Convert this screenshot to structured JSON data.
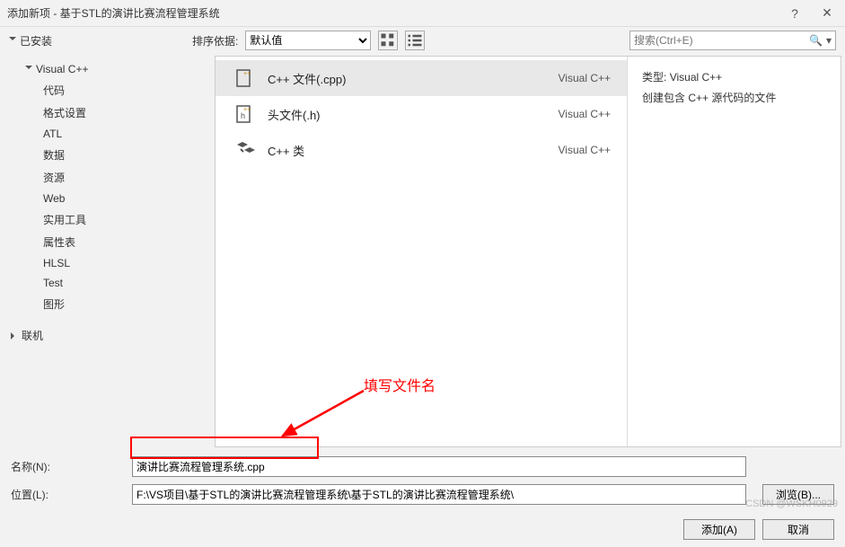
{
  "window": {
    "title": "添加新项 - 基于STL的演讲比赛流程管理系统",
    "help": "?",
    "close": "✕"
  },
  "toolbar": {
    "installed_label": "已安装",
    "sort_label": "排序依据:",
    "sort_value": "默认值",
    "search_placeholder": "搜索(Ctrl+E)"
  },
  "sidebar": {
    "root": "Visual C++",
    "children": [
      "代码",
      "格式设置",
      "ATL",
      "数据",
      "资源",
      "Web",
      "实用工具",
      "属性表",
      "HLSL",
      "Test",
      "图形"
    ],
    "online": "联机"
  },
  "items": [
    {
      "name": "C++ 文件(.cpp)",
      "lang": "Visual C++",
      "selected": true
    },
    {
      "name": "头文件(.h)",
      "lang": "Visual C++",
      "selected": false
    },
    {
      "name": "C++ 类",
      "lang": "Visual C++",
      "selected": false
    }
  ],
  "detail": {
    "type_label": "类型:",
    "type_value": "Visual C++",
    "description": "创建包含 C++ 源代码的文件"
  },
  "form": {
    "name_label": "名称(N):",
    "name_value": "演讲比赛流程管理系统.cpp",
    "location_label": "位置(L):",
    "location_value": "F:\\VS项目\\基于STL的演讲比赛流程管理系统\\基于STL的演讲比赛流程管理系统\\",
    "browse_label": "浏览(B)...",
    "add_label": "添加(A)",
    "cancel_label": "取消"
  },
  "annotation": {
    "text": "填写文件名"
  },
  "watermark": "CSDN @WSKH0929"
}
